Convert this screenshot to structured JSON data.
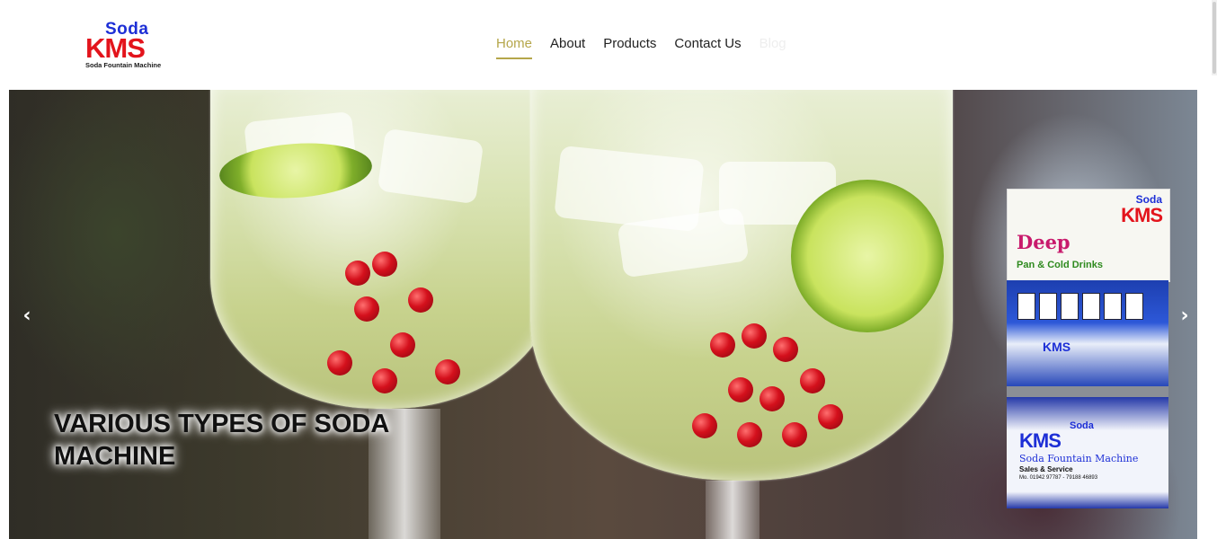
{
  "header": {
    "logo": {
      "top_word": "Soda",
      "brand": "KMS",
      "tagline": "Soda Fountain Machine"
    },
    "nav": {
      "items": [
        {
          "label": "Home",
          "active": true
        },
        {
          "label": "About",
          "active": false
        },
        {
          "label": "Products",
          "active": false
        },
        {
          "label": "Contact Us",
          "active": false
        },
        {
          "label": "Blog",
          "active": false
        }
      ]
    }
  },
  "slider": {
    "caption": "VARIOUS TYPES OF SODA MACHINE",
    "prev_icon": "chevron-left-icon",
    "next_icon": "chevron-right-icon",
    "machine_panel": {
      "soda": "Soda",
      "brand": "KMS",
      "title": "Deep",
      "subtitle": "Pan & Cold Drinks",
      "lower_soda": "Soda",
      "lower_brand": "KMS",
      "lower_line1": "Soda Fountain Machine",
      "lower_line2": "Sales & Service",
      "lower_line3": "Mo. 01942 97787 - 79188 46893"
    }
  },
  "colors": {
    "accent": "#b5a64a",
    "nav_text": "#222222",
    "logo_blue": "#1d2fd6",
    "logo_red": "#e3141c",
    "logo_yellow": "#f2c200"
  }
}
